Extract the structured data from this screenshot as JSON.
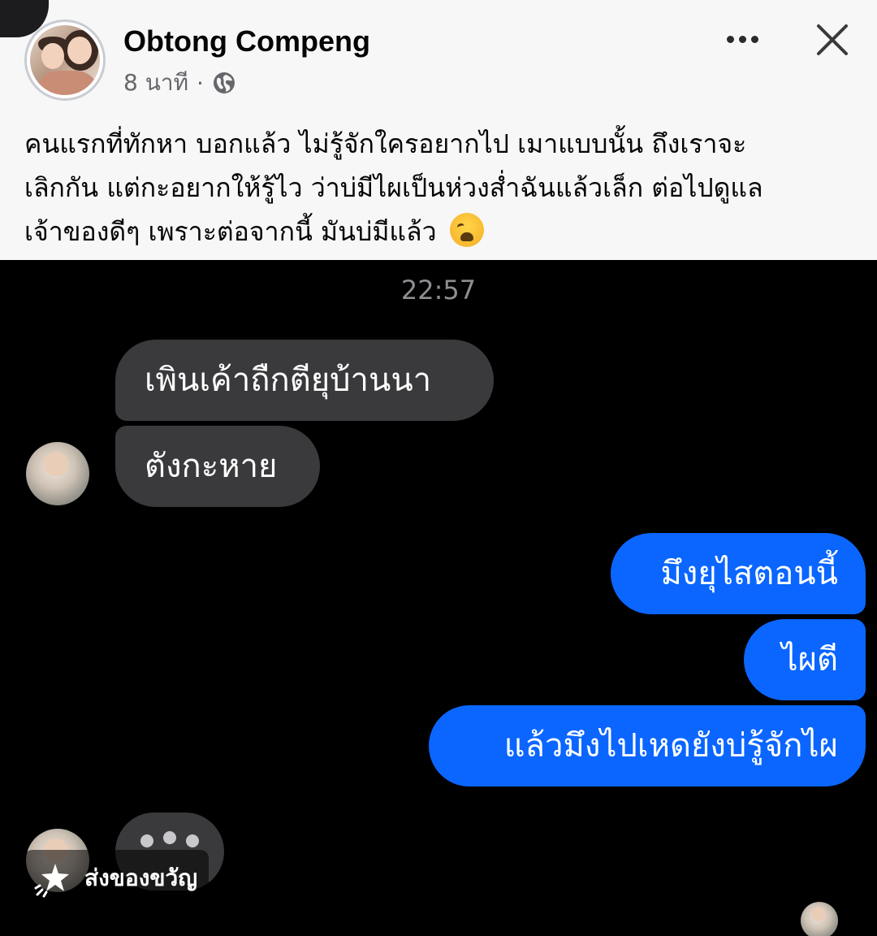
{
  "post": {
    "author": "Obtong Compeng",
    "time": "8 นาที",
    "separator": "·",
    "audience_icon": "globe-icon",
    "text_line_1": "คนแรกที่ทักหา บอกแล้ว ไม่รู้จักใครอยากไป เมาแบบนั้น ถึงเราจะ",
    "text_line_2": "เลิกกัน แต่กะอยากให้รู้ไว ว่าบ่มีไผเป็นห่วงส่ำฉันแล้วเล็ก ต่อไปดูแล",
    "text_line_3": "เจ้าของดีๆ เพราะต่อจากนี้ มันบ่มีแล้ว",
    "emoji": "weary-face-emoji"
  },
  "chat": {
    "time": "22:57",
    "messages": [
      {
        "side": "incoming",
        "text": "เพินเค้าถืกตียุบ้านนา"
      },
      {
        "side": "incoming",
        "text": "ตังกะหาย"
      },
      {
        "side": "outgoing",
        "text": "มึงยุไสตอนนี้"
      },
      {
        "side": "outgoing",
        "text": "ไผตี"
      },
      {
        "side": "outgoing",
        "text": "แล้วมึงไปเหดยังบ่รู้จักไผ"
      }
    ],
    "gift_label": "ส่งของขวัญ"
  },
  "colors": {
    "outgoing_bubble": "#0a66ff",
    "incoming_bubble": "#3a3a3c",
    "chat_background": "#000000",
    "post_background": "#f7f7f8"
  }
}
